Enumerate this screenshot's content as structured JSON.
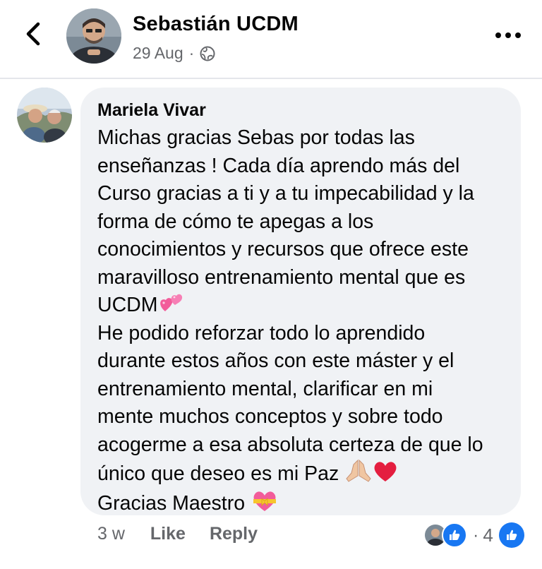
{
  "header": {
    "author_name": "Sebastián UCDM",
    "date": "29 Aug",
    "separator": "·",
    "back_icon": "chevron-left-icon",
    "privacy_icon": "globe-icon",
    "more_icon": "ellipsis-icon"
  },
  "comment": {
    "author": "Mariela Vivar",
    "lines": [
      "Michas gracias Sebas por todas las",
      "enseñanzas ! Cada día aprendo más del",
      "Curso gracias a ti y a tu impecabilidad y la",
      "forma de cómo te apegas a los",
      "conocimientos y recursos que ofrece este",
      "maravilloso entrenamiento mental que es",
      "UCDM",
      "He podido reforzar todo lo aprendido",
      "durante estos años con este máster y el",
      "entrenamiento mental, clarificar en mi",
      "mente muchos conceptos y sobre todo",
      "acogerme a esa absoluta certeza de que lo",
      "único que deseo es mi Paz",
      "Gracias Maestro"
    ],
    "emojis": {
      "line7": "two-hearts-emoji",
      "line13": "praying-hands-emoji, red-heart-emoji",
      "line14": "heart-with-ribbon-emoji"
    }
  },
  "actions": {
    "time": "3 w",
    "like_label": "Like",
    "reply_label": "Reply",
    "reaction_separator": "·",
    "reaction_count": "4",
    "reaction_icon": "thumbs-up-icon"
  },
  "colors": {
    "accent": "#1877f2",
    "bubble": "#f0f2f5",
    "muted_text": "#65676b",
    "text": "#050505",
    "heart_red": "#e41e3f",
    "heart_pink": "#f25c9a"
  }
}
